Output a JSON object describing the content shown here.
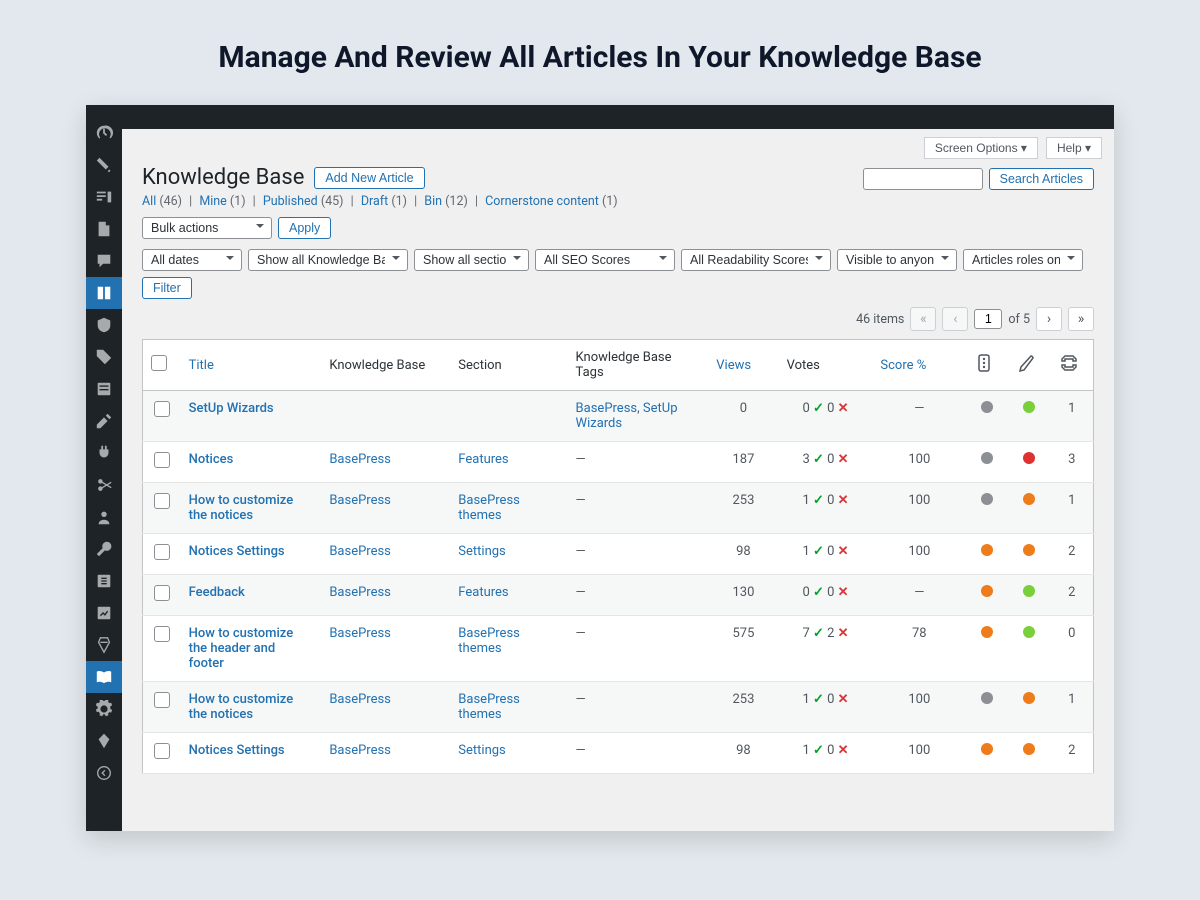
{
  "promo": {
    "title": "Manage And Review All Articles In Your Knowledge Base"
  },
  "header": {
    "screen_options": "Screen Options ▾",
    "help": "Help ▾",
    "page_title": "Knowledge Base",
    "add_new": "Add New Article",
    "search_btn": "Search Articles"
  },
  "subsub": {
    "all": "All",
    "all_count": "(46)",
    "mine": "Mine",
    "mine_count": "(1)",
    "published": "Published",
    "published_count": "(45)",
    "draft": "Draft",
    "draft_count": "(1)",
    "bin": "Bin",
    "bin_count": "(12)",
    "cornerstone": "Cornerstone content",
    "cornerstone_count": "(1)"
  },
  "bulk": {
    "label": "Bulk actions",
    "apply": "Apply"
  },
  "filters": {
    "dates": "All dates",
    "kbs": "Show all Knowledge Bases",
    "sections": "Show all sections",
    "seo": "All SEO Scores",
    "readability": "All Readability Scores",
    "visibility": "Visible to anyone",
    "roles": "Articles roles only",
    "filter_btn": "Filter"
  },
  "pagination": {
    "total_items": "46 items",
    "current": "1",
    "of_text": "of 5",
    "first": "«",
    "prev": "‹",
    "next": "›",
    "last": "»"
  },
  "columns": {
    "title": "Title",
    "kb": "Knowledge Base",
    "section": "Section",
    "tags": "Knowledge Base Tags",
    "views": "Views",
    "votes": "Votes",
    "score": "Score %"
  },
  "rows": [
    {
      "title": "SetUp Wizards",
      "kb": "",
      "section": "",
      "tags": "BasePress, SetUp Wizards",
      "views": "0",
      "up": "0",
      "down": "0",
      "score": "—",
      "seo": "grey",
      "read": "green",
      "links": "1"
    },
    {
      "title": "Notices",
      "kb": "BasePress",
      "section": "Features",
      "tags": "—",
      "views": "187",
      "up": "3",
      "down": "0",
      "score": "100",
      "seo": "grey",
      "read": "red",
      "links": "3"
    },
    {
      "title": "How to customize the notices",
      "kb": "BasePress",
      "section": "BasePress themes",
      "tags": "—",
      "views": "253",
      "up": "1",
      "down": "0",
      "score": "100",
      "seo": "grey",
      "read": "orange",
      "links": "1"
    },
    {
      "title": "Notices Settings",
      "kb": "BasePress",
      "section": "Settings",
      "tags": "—",
      "views": "98",
      "up": "1",
      "down": "0",
      "score": "100",
      "seo": "orange",
      "read": "orange",
      "links": "2"
    },
    {
      "title": "Feedback",
      "kb": "BasePress",
      "section": "Features",
      "tags": "—",
      "views": "130",
      "up": "0",
      "down": "0",
      "score": "—",
      "seo": "orange",
      "read": "green",
      "links": "2"
    },
    {
      "title": "How to customize the header and footer",
      "kb": "BasePress",
      "section": "BasePress themes",
      "tags": "—",
      "views": "575",
      "up": "7",
      "down": "2",
      "score": "78",
      "seo": "orange",
      "read": "green",
      "links": "0"
    },
    {
      "title": "How to customize the notices",
      "kb": "BasePress",
      "section": "BasePress themes",
      "tags": "—",
      "views": "253",
      "up": "1",
      "down": "0",
      "score": "100",
      "seo": "grey",
      "read": "orange",
      "links": "1"
    },
    {
      "title": "Notices Settings",
      "kb": "BasePress",
      "section": "Settings",
      "tags": "—",
      "views": "98",
      "up": "1",
      "down": "0",
      "score": "100",
      "seo": "orange",
      "read": "orange",
      "links": "2"
    }
  ]
}
